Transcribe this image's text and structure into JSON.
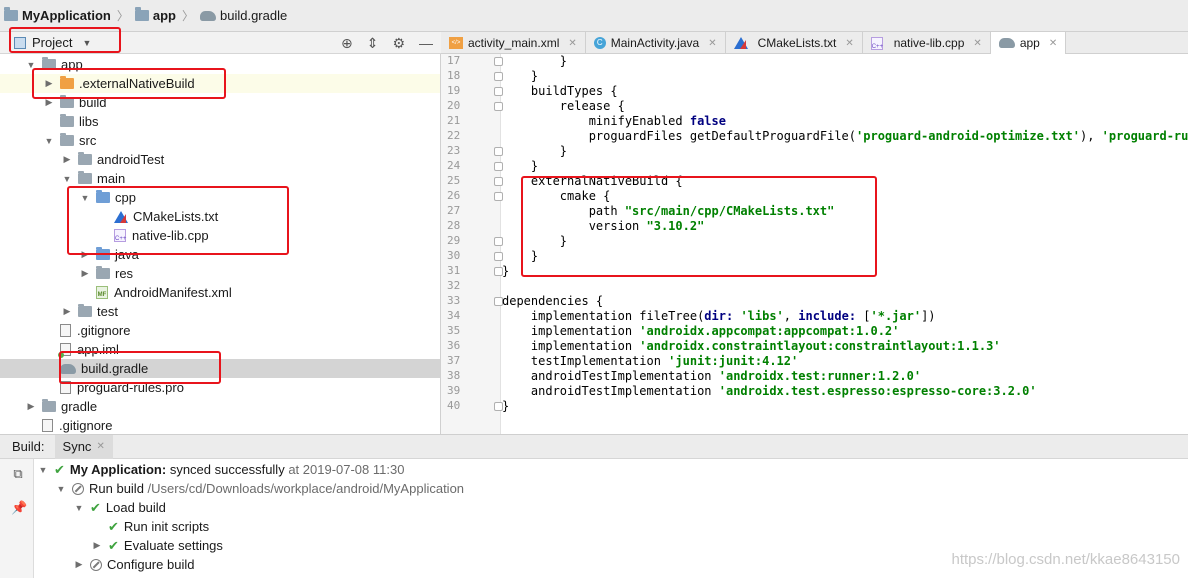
{
  "breadcrumb": {
    "project": "MyApplication",
    "module": "app",
    "file": "build.gradle"
  },
  "project_panel": {
    "view_label": "Project",
    "tree": [
      {
        "label": "app",
        "depth": 0,
        "expanded": true,
        "icon": "folder"
      },
      {
        "label": ".externalNativeBuild",
        "depth": 1,
        "expanded": false,
        "icon": "folder-orange"
      },
      {
        "label": "build",
        "depth": 1,
        "expanded": false,
        "icon": "folder"
      },
      {
        "label": "libs",
        "depth": 1,
        "expanded": null,
        "icon": "folder"
      },
      {
        "label": "src",
        "depth": 1,
        "expanded": true,
        "icon": "folder"
      },
      {
        "label": "androidTest",
        "depth": 2,
        "expanded": false,
        "icon": "folder"
      },
      {
        "label": "main",
        "depth": 2,
        "expanded": true,
        "icon": "folder"
      },
      {
        "label": "cpp",
        "depth": 3,
        "expanded": true,
        "icon": "folder-blue"
      },
      {
        "label": "CMakeLists.txt",
        "depth": 4,
        "expanded": null,
        "icon": "cmake"
      },
      {
        "label": "native-lib.cpp",
        "depth": 4,
        "expanded": null,
        "icon": "cpp"
      },
      {
        "label": "java",
        "depth": 3,
        "expanded": false,
        "icon": "folder-blue"
      },
      {
        "label": "res",
        "depth": 3,
        "expanded": false,
        "icon": "folder"
      },
      {
        "label": "AndroidManifest.xml",
        "depth": 3,
        "expanded": null,
        "icon": "manifest"
      },
      {
        "label": "test",
        "depth": 2,
        "expanded": false,
        "icon": "folder"
      },
      {
        "label": ".gitignore",
        "depth": 1,
        "expanded": null,
        "icon": "file"
      },
      {
        "label": "app.iml",
        "depth": 1,
        "expanded": null,
        "icon": "iml"
      },
      {
        "label": "build.gradle",
        "depth": 1,
        "expanded": null,
        "icon": "gradle"
      },
      {
        "label": "proguard-rules.pro",
        "depth": 1,
        "expanded": null,
        "icon": "file"
      },
      {
        "label": "gradle",
        "depth": 0,
        "expanded": false,
        "icon": "folder"
      },
      {
        "label": ".gitignore",
        "depth": 0,
        "expanded": null,
        "icon": "file"
      }
    ]
  },
  "editor_tabs": [
    {
      "label": "activity_main.xml",
      "icon": "xml"
    },
    {
      "label": "MainActivity.java",
      "icon": "class"
    },
    {
      "label": "CMakeLists.txt",
      "icon": "cmake"
    },
    {
      "label": "native-lib.cpp",
      "icon": "cpp"
    },
    {
      "label": "app",
      "icon": "gradle",
      "active": true
    }
  ],
  "editor": {
    "lines": [
      {
        "n": "17",
        "code": "        }"
      },
      {
        "n": "18",
        "code": "    }"
      },
      {
        "n": "19",
        "code": "    buildTypes {"
      },
      {
        "n": "20",
        "code": "        release {"
      },
      {
        "n": "21",
        "code": "            minifyEnabled false"
      },
      {
        "n": "22",
        "code": "            proguardFiles getDefaultProguardFile('proguard-android-optimize.txt'), 'proguard-rules"
      },
      {
        "n": "23",
        "code": "        }"
      },
      {
        "n": "24",
        "code": "    }"
      },
      {
        "n": "25",
        "code": "    externalNativeBuild {"
      },
      {
        "n": "26",
        "code": "        cmake {"
      },
      {
        "n": "27",
        "code": "            path \"src/main/cpp/CMakeLists.txt\""
      },
      {
        "n": "28",
        "code": "            version \"3.10.2\""
      },
      {
        "n": "29",
        "code": "        }"
      },
      {
        "n": "30",
        "code": "    }"
      },
      {
        "n": "31",
        "code": "}"
      },
      {
        "n": "32",
        "code": ""
      },
      {
        "n": "33",
        "code": "dependencies {"
      },
      {
        "n": "34",
        "code": "    implementation fileTree(dir: 'libs', include: ['*.jar'])"
      },
      {
        "n": "35",
        "code": "    implementation 'androidx.appcompat:appcompat:1.0.2'"
      },
      {
        "n": "36",
        "code": "    implementation 'androidx.constraintlayout:constraintlayout:1.1.3'"
      },
      {
        "n": "37",
        "code": "    testImplementation 'junit:junit:4.12'"
      },
      {
        "n": "38",
        "code": "    androidTestImplementation 'androidx.test:runner:1.2.0'"
      },
      {
        "n": "39",
        "code": "    androidTestImplementation 'androidx.test.espresso:espresso-core:3.2.0'"
      },
      {
        "n": "40",
        "code": "}"
      }
    ]
  },
  "build_panel": {
    "title": "Build:",
    "tab": "Sync",
    "rows": [
      {
        "depth": 0,
        "status": "ok",
        "bold": "My Application:",
        "text": " synced successfully",
        "muted": " at 2019-07-08 11:30"
      },
      {
        "depth": 1,
        "status": "running",
        "bold": "",
        "text": "Run build",
        "muted": " /Users/cd/Downloads/workplace/android/MyApplication"
      },
      {
        "depth": 2,
        "status": "ok",
        "bold": "",
        "text": "Load build",
        "muted": ""
      },
      {
        "depth": 3,
        "status": "ok",
        "bold": "",
        "text": "Run init scripts",
        "muted": ""
      },
      {
        "depth": 3,
        "status": "ok",
        "bold": "",
        "text": "Evaluate settings",
        "muted": ""
      },
      {
        "depth": 2,
        "status": "running",
        "bold": "",
        "text": "Configure build",
        "muted": ""
      }
    ]
  },
  "watermark": "https://blog.csdn.net/kkae8643150",
  "colors": {
    "highlight_box": "#e8141c",
    "keyword": "#000080",
    "string": "#008000",
    "success": "#3fa33f"
  }
}
